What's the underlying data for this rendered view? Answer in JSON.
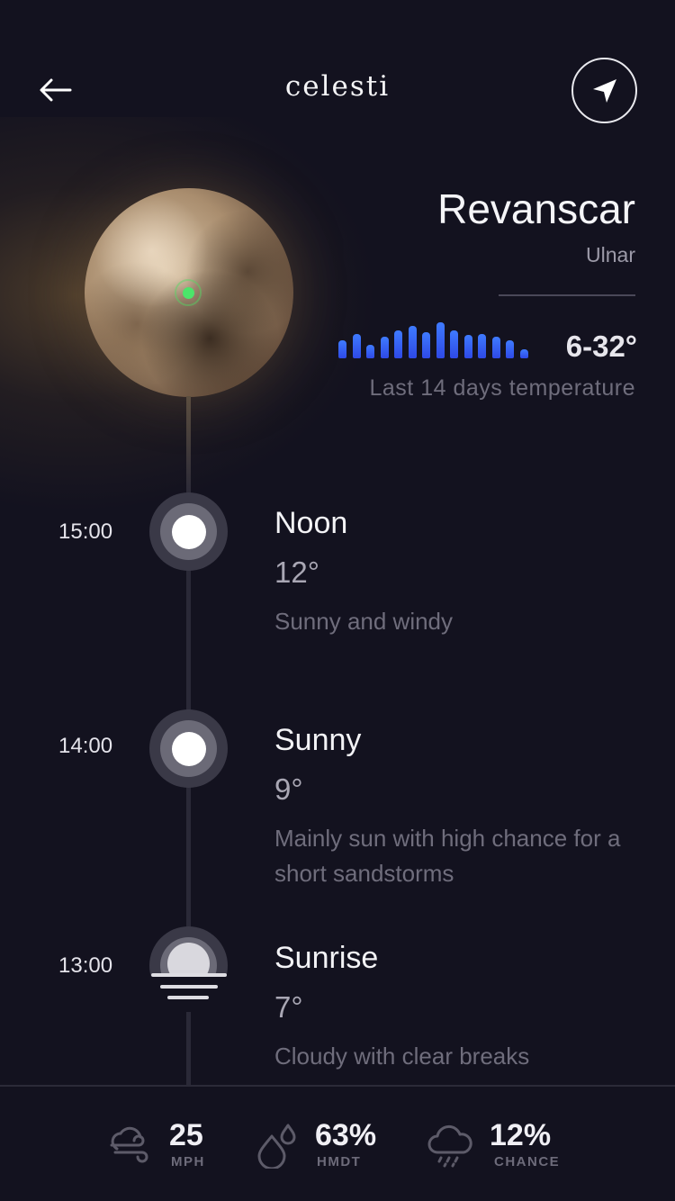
{
  "header": {
    "app_title": "celesti",
    "back_icon": "arrow-left-icon",
    "locate_icon": "navigation-arrow-icon"
  },
  "location": {
    "name": "Revanscar",
    "region": "Ulnar",
    "temperature_range": "6-32°",
    "temperature_caption": "Last 14 days temperature",
    "last_14_days_relative_levels": [
      0.45,
      0.62,
      0.35,
      0.55,
      0.7,
      0.82,
      0.66,
      0.92,
      0.7,
      0.6,
      0.62,
      0.55,
      0.45,
      0.22
    ]
  },
  "timeline": [
    {
      "time": "15:00",
      "title": "Noon",
      "temp": "12°",
      "desc": "Sunny and windy",
      "icon": "sun-icon"
    },
    {
      "time": "14:00",
      "title": "Sunny",
      "temp": "9°",
      "desc": "Mainly sun with high chance for a short sandstorms",
      "icon": "sun-icon"
    },
    {
      "time": "13:00",
      "title": "Sunrise",
      "temp": "7°",
      "desc": "Cloudy with clear breaks",
      "icon": "sunrise-icon"
    }
  ],
  "stats": [
    {
      "icon": "wind-cloud-icon",
      "value": "25",
      "unit": "MPH"
    },
    {
      "icon": "humidity-drops-icon",
      "value": "63%",
      "unit": "HMDT"
    },
    {
      "icon": "rain-cloud-icon",
      "value": "12%",
      "unit": "CHANCE"
    }
  ],
  "colors": {
    "background": "#13121f",
    "accent_blue": "#3f7bff",
    "marker_green": "#4ce56a"
  }
}
